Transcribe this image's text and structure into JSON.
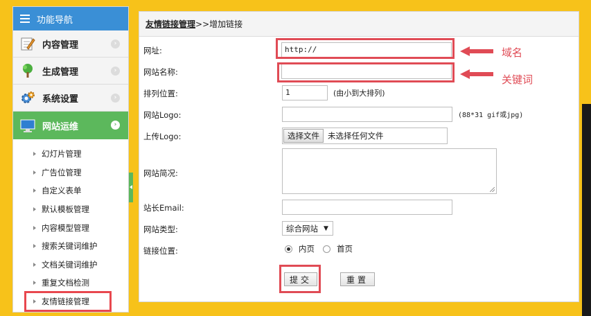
{
  "sidebar": {
    "header": "功能导航",
    "menus": [
      {
        "label": "内容管理",
        "icon": "edit-icon"
      },
      {
        "label": "生成管理",
        "icon": "tree-icon"
      },
      {
        "label": "系统设置",
        "icon": "gear-icon"
      },
      {
        "label": "网站运维",
        "icon": "monitor-icon",
        "active": true
      }
    ],
    "subitems": [
      "幻灯片管理",
      "广告位管理",
      "自定义表单",
      "默认模板管理",
      "内容模型管理",
      "搜索关键词维护",
      "文档关键词维护",
      "重复文档检测",
      "友情链接管理"
    ]
  },
  "breadcrumb": {
    "link": "友情链接管理",
    "current": ">>增加链接"
  },
  "form": {
    "url_label": "网址:",
    "url_value": "http://",
    "name_label": "网站名称:",
    "name_value": "",
    "order_label": "排列位置:",
    "order_value": "1",
    "order_hint": "(由小到大排列)",
    "logo_label": "网站Logo:",
    "logo_value": "",
    "logo_hint": "(88*31 gif或jpg)",
    "upload_label": "上传Logo:",
    "upload_button": "选择文件",
    "upload_status": "未选择任何文件",
    "desc_label": "网站简况:",
    "email_label": "站长Email:",
    "email_value": "",
    "type_label": "网站类型:",
    "type_value": "综合网站",
    "position_label": "链接位置:",
    "position_options": [
      "内页",
      "首页"
    ],
    "position_selected": "内页",
    "submit": "提交",
    "reset": "重置"
  },
  "annotations": {
    "domain": "域名",
    "keyword": "关键词"
  },
  "colors": {
    "accent_blue": "#3a8fd6",
    "active_green": "#5cb85c",
    "annotation_red": "#e04b55",
    "background_yellow": "#f7c21a"
  }
}
